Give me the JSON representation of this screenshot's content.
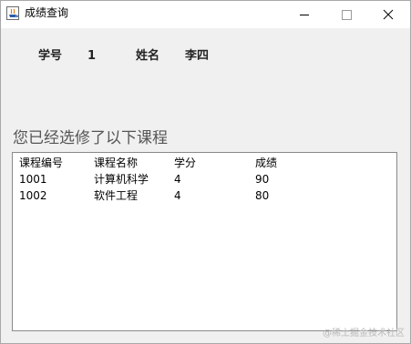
{
  "window": {
    "title": "成绩查询",
    "controls": {
      "minimize_icon": "minimize-icon",
      "maximize_icon": "maximize-icon",
      "close_icon": "close-icon"
    }
  },
  "student": {
    "id_label": "学号",
    "id_value": "1",
    "name_label": "姓名",
    "name_value": "李四"
  },
  "section_heading": "您已经选修了以下课程",
  "table": {
    "columns": [
      "课程编号",
      "课程名称",
      "学分",
      "成绩"
    ],
    "rows": [
      [
        "1001",
        "计算机科学",
        "4",
        "90"
      ],
      [
        "1002",
        "软件工程",
        "4",
        "80"
      ]
    ]
  },
  "watermark": "@稀土掘金技术社区",
  "colors": {
    "window_bg": "#f0f0f0",
    "titlebar_bg": "#ffffff",
    "table_bg": "#ffffff",
    "heading_text": "#555555"
  }
}
